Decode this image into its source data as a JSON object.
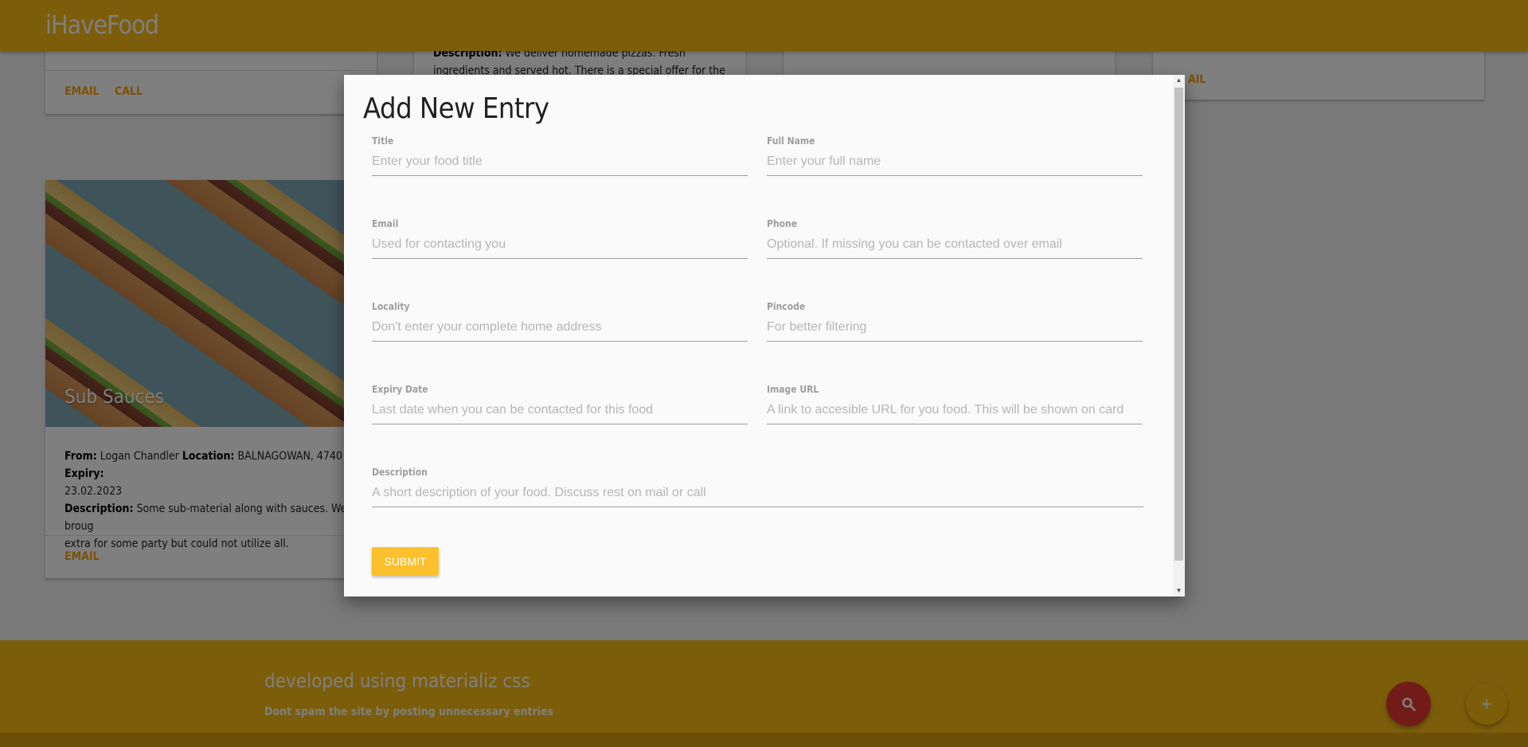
{
  "navbar": {
    "brand": "iHaveFood"
  },
  "cards": {
    "top_left": {
      "email": "EMAIL",
      "call": "CALL"
    },
    "top_middle": {
      "description_label": "Description:",
      "description_text": " We deliver homemade pizzas. Fresh ingredients and served hot. There is a special offer for the first few"
    },
    "top_right": {
      "email_partial": "AIL"
    },
    "sub_sauces": {
      "title": "Sub Sauces",
      "from_label": "From:",
      "from_value": " Logan Chandler ",
      "location_label": "Location:",
      "location_value": " BALNAGOWAN, 4740 ",
      "expiry_label": "Expiry:",
      "expiry_value": "23.02.2023",
      "description_label": "Description:",
      "description_text": " Some sub-material along with sauces. We broug",
      "description_text_2": "extra for some party but could not utilize all.",
      "email": "EMAIL"
    }
  },
  "modal": {
    "title": "Add New Entry",
    "fields": [
      {
        "label": "Title",
        "placeholder": "Enter your food title"
      },
      {
        "label": "Full Name",
        "placeholder": "Enter your full name"
      },
      {
        "label": "Email",
        "placeholder": "Used for contacting you"
      },
      {
        "label": "Phone",
        "placeholder": "Optional. If missing you can be contacted over email"
      },
      {
        "label": "Locality",
        "placeholder": "Don't enter your complete home address"
      },
      {
        "label": "Pincode",
        "placeholder": "For better filtering"
      },
      {
        "label": "Expiry Date",
        "placeholder": "Last date when you can be contacted for this food"
      },
      {
        "label": "Image URL",
        "placeholder": "A link to accesible URL for you food. This will be shown on card"
      },
      {
        "label": "Description",
        "placeholder": "A short description of your food. Discuss rest on mail or call"
      }
    ],
    "submit_label": "SUBMIT"
  },
  "footer": {
    "title": "developed using materializ css",
    "subtitle": "Dont spam the site by posting unnecessary entries"
  },
  "fabs": {
    "search_icon": "search-icon",
    "add_icon": "plus-icon"
  },
  "colors": {
    "primary": "#f9ba15",
    "accent": "#f9a20f",
    "fab_red": "#e53935",
    "submit": "#fbc02d"
  }
}
